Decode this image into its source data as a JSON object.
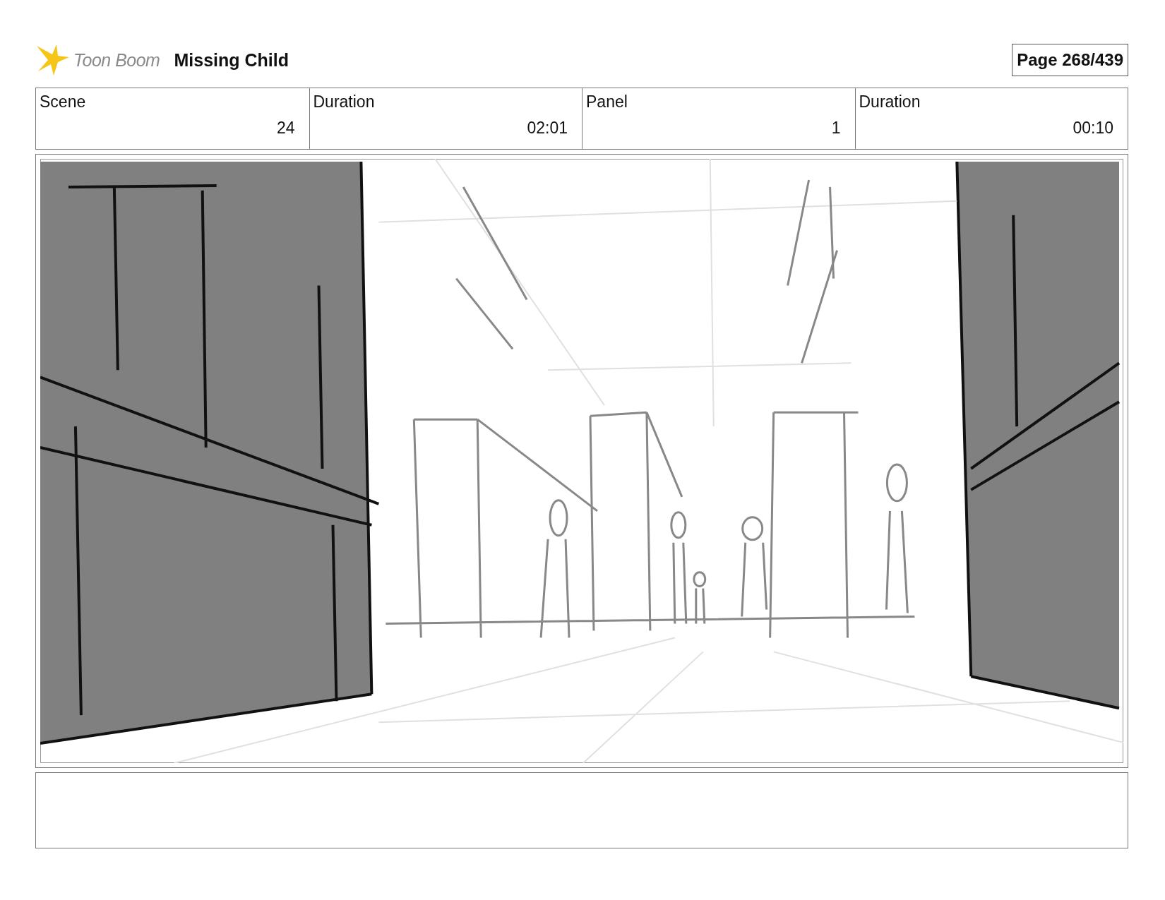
{
  "header": {
    "logo_text": "Toon Boom",
    "project_title": "Missing Child",
    "page": "Page 268/439"
  },
  "info": [
    {
      "label": "Scene",
      "value": "24"
    },
    {
      "label": "Duration",
      "value": "02:01"
    },
    {
      "label": "Panel",
      "value": "1"
    },
    {
      "label": "Duration",
      "value": "00:10"
    }
  ]
}
